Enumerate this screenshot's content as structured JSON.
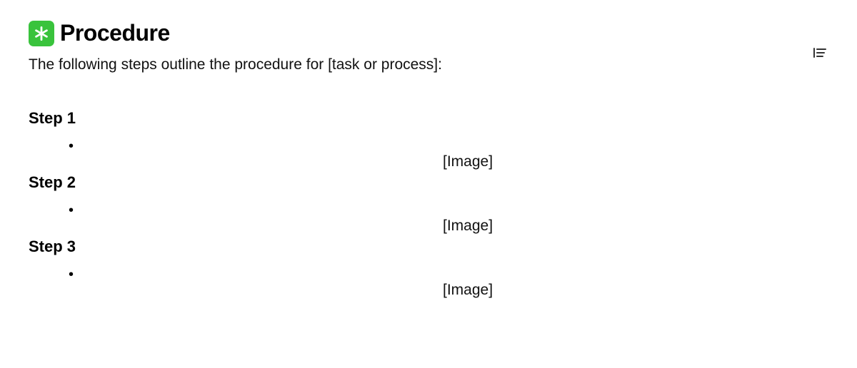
{
  "heading": {
    "icon_name": "asterisk-badge-icon",
    "title": "Procedure"
  },
  "intro": "The following steps outline the procedure for [task or process]:",
  "steps": [
    {
      "title": "Step 1",
      "image_placeholder": "[Image]"
    },
    {
      "title": "Step 2",
      "image_placeholder": "[Image]"
    },
    {
      "title": "Step 3",
      "image_placeholder": "[Image]"
    }
  ],
  "bullet_glyph": "•"
}
